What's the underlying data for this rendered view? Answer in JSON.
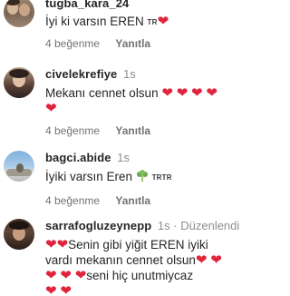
{
  "comments": [
    {
      "username": "tugba_kara_24",
      "time": "",
      "edited": "",
      "text": "İyi ki varsın EREN",
      "flag": "TR",
      "likes": "4 beğenme",
      "reply": "Yanıtla"
    },
    {
      "username": "civelekrefiye",
      "time": "1s",
      "edited": "",
      "text": "Mekanı cennet olsun",
      "flag": "",
      "likes": "4 beğenme",
      "reply": "Yanıtla"
    },
    {
      "username": "bagci.abide",
      "time": "1s",
      "edited": "",
      "text": "İyiki varsın Eren",
      "flag": "TRTR",
      "likes": "4 beğenme",
      "reply": "Yanıtla"
    },
    {
      "username": "sarrafogluzeynepp",
      "time": "1s",
      "edited": "Düzenlendi",
      "text_a": "Senin gibi yiğit EREN iyiki",
      "text_b": "vardı mekanın cennet olsun",
      "text_c": "seni hiç unutmiycaz",
      "flag": "",
      "likes": "",
      "reply": ""
    }
  ],
  "colors": {
    "heart": "#e0243b",
    "secondary_text": "#8e8e8e",
    "primary_text": "#262626"
  },
  "icons": [
    "heart-icon",
    "tr-flag-icon",
    "broccoli-emoji-icon"
  ]
}
